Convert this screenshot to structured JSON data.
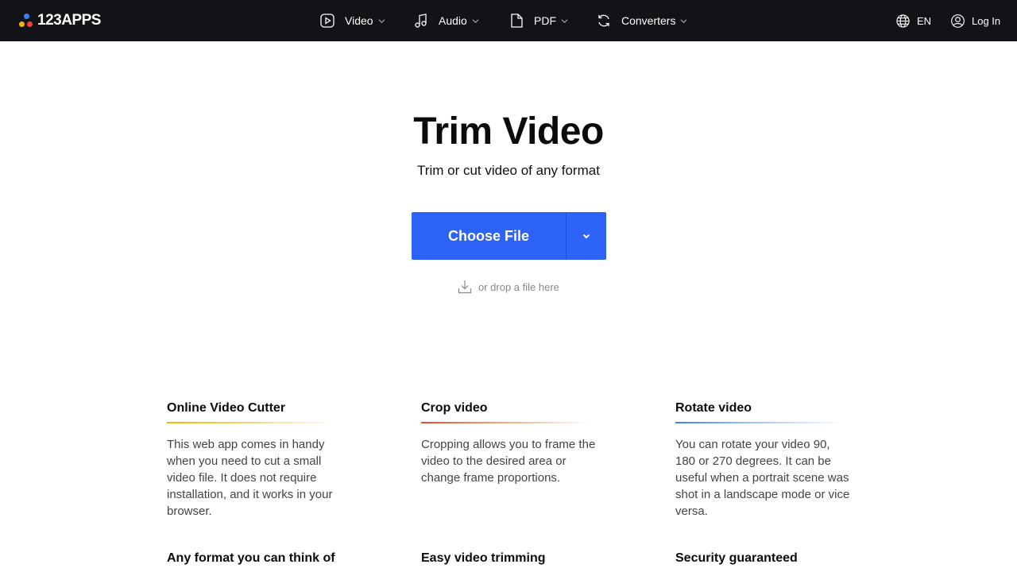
{
  "header": {
    "logo_text": "123APPS",
    "nav": [
      {
        "label": "Video",
        "icon": "play-square-icon"
      },
      {
        "label": "Audio",
        "icon": "music-note-icon"
      },
      {
        "label": "PDF",
        "icon": "document-icon"
      },
      {
        "label": "Converters",
        "icon": "convert-arrows-icon"
      }
    ],
    "language": "EN",
    "login": "Log In"
  },
  "hero": {
    "title": "Trim Video",
    "subtitle": "Trim or cut video of any format",
    "choose_file": "Choose File",
    "drop_hint": "or drop a file here"
  },
  "features": [
    {
      "title": "Online Video Cutter",
      "text": "This web app comes in handy when you need to cut a small video file. It does not require installation, and it works in your browser.",
      "accent": "#f5b400"
    },
    {
      "title": "Crop video",
      "text": "Cropping allows you to frame the video to the desired area or change frame proportions.",
      "accent": "#f0443a"
    },
    {
      "title": "Rotate video",
      "text": "You can rotate your video 90, 180 or 270 degrees. It can be useful when a portrait scene was shot in a landscape mode or vice versa.",
      "accent": "#3b82f6"
    },
    {
      "title": "Any format you can think of",
      "text": ""
    },
    {
      "title": "Easy video trimming",
      "text": ""
    },
    {
      "title": "Security guaranteed",
      "text": ""
    }
  ],
  "colors": {
    "header_bg": "#121317",
    "primary_button": "#2d63f6"
  }
}
